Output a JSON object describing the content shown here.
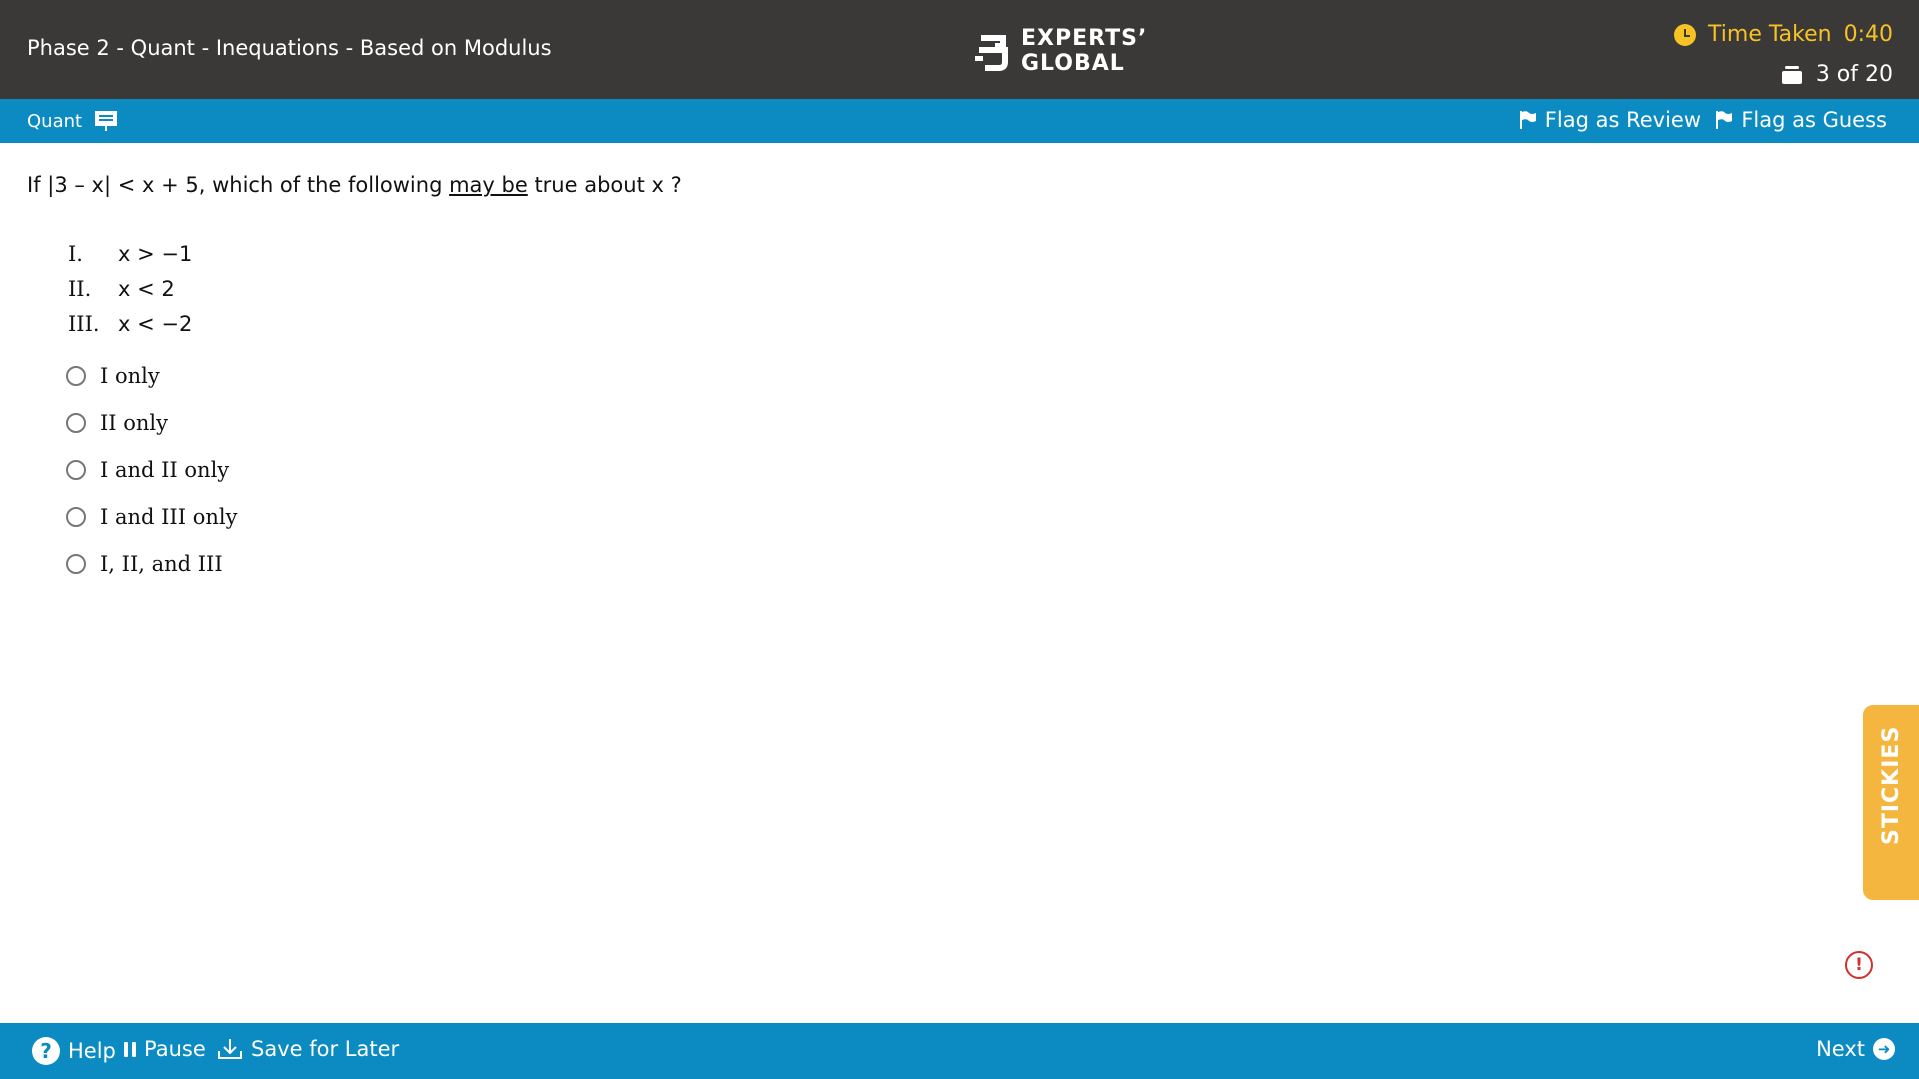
{
  "header": {
    "title": "Phase 2 - Quant - Inequations - Based on Modulus",
    "logo": {
      "line1": "EXPERTS’",
      "line2": "GLOBAL"
    },
    "timer": {
      "label": "Time Taken",
      "value": "0:40",
      "icon": "clock-icon"
    },
    "progress": {
      "text": "3 of 20",
      "icon": "stack-icon"
    }
  },
  "toolbar": {
    "section": "Quant",
    "section_icon": "calculator-board-icon",
    "flag_review": "Flag as Review",
    "flag_guess": "Flag as Guess"
  },
  "question": {
    "prefix": "If |3 – x| < x + 5, which of the following ",
    "emphasis": "may be",
    "suffix": " true about x ?",
    "statements": [
      {
        "num": "I.",
        "expr": "x > −1"
      },
      {
        "num": "II.",
        "expr": "x < 2"
      },
      {
        "num": "III.",
        "expr": "x < −2"
      }
    ],
    "options": [
      "I only",
      "II only",
      "I and II only",
      "I and III only",
      "I, II, and III"
    ]
  },
  "stickies": {
    "label": "STICKIES"
  },
  "footer": {
    "help": "Help",
    "pause": "Pause",
    "save": "Save for Later",
    "next": "Next"
  },
  "colors": {
    "header_bg": "#3b3838",
    "accent_blue": "#0b8bc2",
    "timer_yellow": "#f6c224",
    "stickies_orange": "#f5b63f",
    "alert_red": "#d32f2f"
  }
}
